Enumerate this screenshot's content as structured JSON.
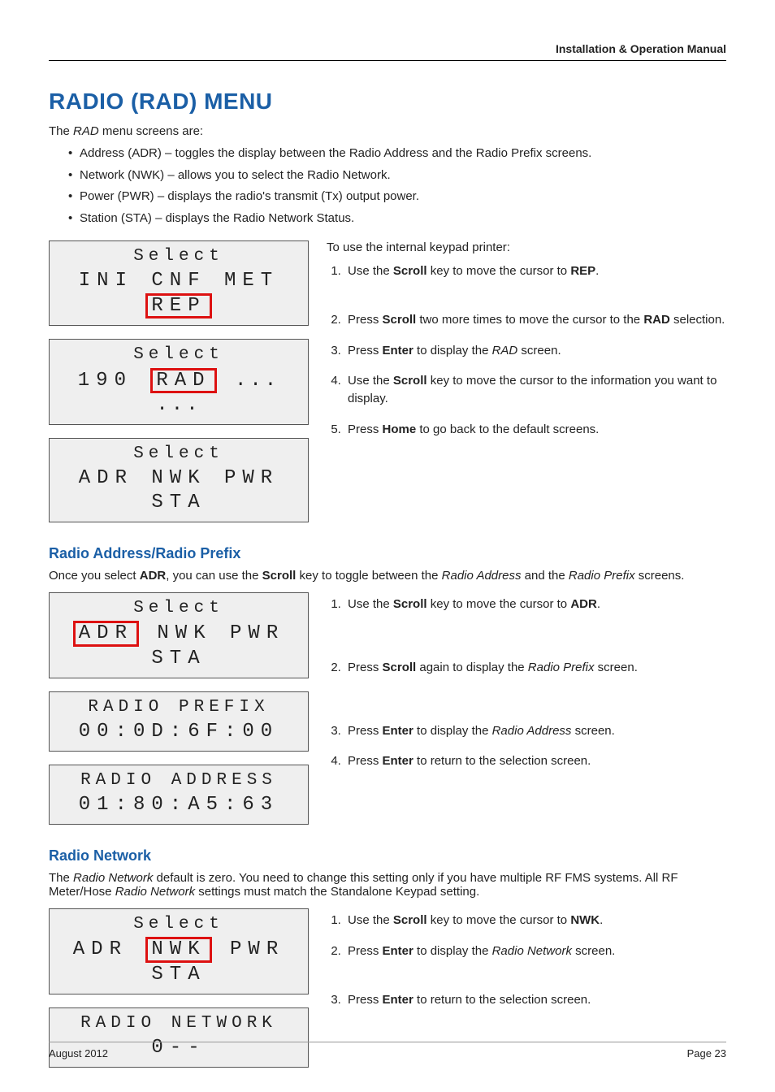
{
  "header": {
    "running": "Installation & Operation Manual"
  },
  "title": "RADIO (RAD) MENU",
  "intro": {
    "pre": "The ",
    "ital": "RAD",
    "post": " menu screens are:"
  },
  "bullets": [
    "Address (ADR) – toggles the display between the Radio Address and the Radio Prefix screens.",
    "Network (NWK) – allows you to select the Radio Network.",
    "Power (PWR) – displays the radio's transmit (Tx) output power.",
    "Station (STA) – displays the Radio Network Status."
  ],
  "block1": {
    "lcd": [
      {
        "l1": "Select",
        "l2_pre": "INI CNF MET ",
        "l2_sel": "REP",
        "l2_post": ""
      },
      {
        "l1": "Select",
        "l2_pre": "190 ",
        "l2_sel": "RAD",
        "l2_post": " ",
        "dots": "... ..."
      },
      {
        "l1": "Select",
        "l2": "ADR NWK PWR STA"
      }
    ],
    "lead": "To use the internal keypad printer:",
    "steps": [
      {
        "t": [
          "Use the ",
          {
            "b": "Scroll"
          },
          " key to move the cursor to ",
          {
            "b": "REP"
          },
          "."
        ]
      },
      {
        "t": [
          "Press ",
          {
            "b": "Scroll"
          },
          " two more times to move the cursor to the ",
          {
            "b": "RAD"
          },
          " selection."
        ]
      },
      {
        "t": [
          "Press ",
          {
            "b": "Enter"
          },
          " to display the ",
          {
            "i": "RAD"
          },
          " screen."
        ]
      },
      {
        "t": [
          "Use the ",
          {
            "b": "Scroll"
          },
          " key to move the cursor to the information you want to display."
        ]
      },
      {
        "t": [
          "Press ",
          {
            "b": "Home"
          },
          " to go back to the default screens."
        ]
      }
    ]
  },
  "sec2": {
    "title": "Radio Address/Radio Prefix",
    "intro": {
      "parts": [
        "Once you select ",
        {
          "b": "ADR"
        },
        ", you can use the ",
        {
          "b": "Scroll"
        },
        " key to toggle between the ",
        {
          "i": "Radio Address"
        },
        " and the ",
        {
          "i": "Radio Prefix"
        },
        " screens."
      ]
    },
    "lcd": [
      {
        "l1": "Select",
        "l2_pre": "",
        "l2_sel": "ADR",
        "l2_post": " NWK PWR STA"
      },
      {
        "l1": "RADIO PREFIX",
        "l2": "00:0D:6F:00"
      },
      {
        "l1": "RADIO ADDRESS",
        "l2": "01:80:A5:63"
      }
    ],
    "steps": [
      {
        "t": [
          "Use the ",
          {
            "b": "Scroll"
          },
          " key to move the cursor to ",
          {
            "b": "ADR"
          },
          "."
        ]
      },
      {
        "t": [
          "Press ",
          {
            "b": "Scroll"
          },
          " again to display the ",
          {
            "i": "Radio Prefix"
          },
          " screen."
        ]
      },
      {
        "t": [
          "Press ",
          {
            "b": "Enter"
          },
          " to display the ",
          {
            "i": "Radio Address"
          },
          " screen."
        ]
      },
      {
        "t": [
          "Press ",
          {
            "b": "Enter"
          },
          " to return to the selection screen."
        ]
      }
    ]
  },
  "sec3": {
    "title": "Radio Network",
    "intro": {
      "parts": [
        "The ",
        {
          "i": "Radio Network"
        },
        " default is zero. You need to change this setting only if you have multiple RF FMS systems. All RF Meter/Hose ",
        {
          "i": "Radio Network"
        },
        " settings must match the Standalone Keypad setting."
      ]
    },
    "lcd": [
      {
        "l1": "Select",
        "l2_pre": "ADR ",
        "l2_sel": "NWK",
        "l2_post": " PWR STA"
      },
      {
        "l1": "RADIO NETWORK",
        "l2": "0--"
      }
    ],
    "steps": [
      {
        "t": [
          "Use the ",
          {
            "b": "Scroll"
          },
          " key to move the cursor to ",
          {
            "b": "NWK"
          },
          "."
        ]
      },
      {
        "t": [
          "Press ",
          {
            "b": "Enter"
          },
          " to display the ",
          {
            "i": "Radio Network"
          },
          " screen."
        ]
      },
      {
        "t": [
          "Press ",
          {
            "b": "Enter"
          },
          " to return to the selection screen."
        ]
      }
    ]
  },
  "footer": {
    "left": "August 2012",
    "right": "Page 23"
  }
}
